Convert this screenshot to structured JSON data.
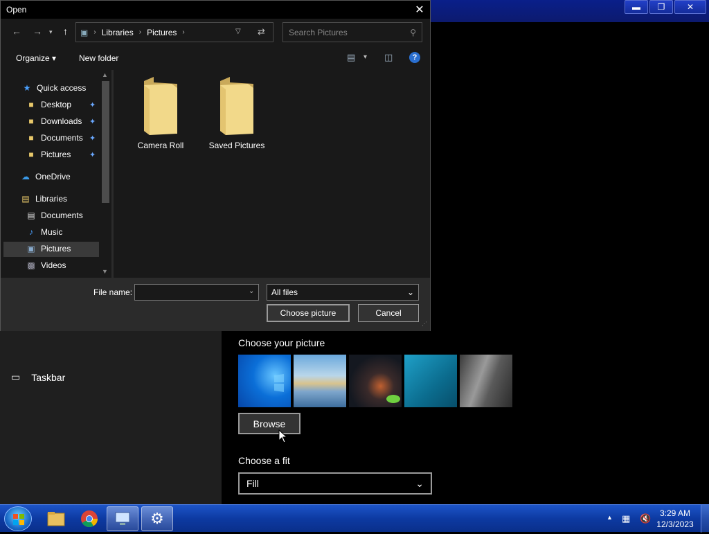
{
  "dialog": {
    "title": "Open",
    "breadcrumb": [
      "Libraries",
      "Pictures"
    ],
    "search_placeholder": "Search Pictures",
    "organize_label": "Organize",
    "new_folder_label": "New folder",
    "nav_items": {
      "quick_access": "Quick access",
      "desktop": "Desktop",
      "downloads": "Downloads",
      "documents_qa": "Documents",
      "pictures_qa": "Pictures",
      "onedrive": "OneDrive",
      "libraries": "Libraries",
      "documents_lib": "Documents",
      "music": "Music",
      "pictures_lib": "Pictures",
      "videos": "Videos"
    },
    "folders": [
      "Camera Roll",
      "Saved Pictures"
    ],
    "file_name_label": "File name:",
    "file_name_value": "",
    "file_type_value": "All files",
    "choose_button": "Choose picture",
    "cancel_button": "Cancel"
  },
  "settings": {
    "taskbar_nav_label": "Taskbar",
    "choose_picture_label": "Choose your picture",
    "browse_button": "Browse",
    "choose_fit_label": "Choose a fit",
    "fit_value": "Fill"
  },
  "taskbar": {
    "time": "3:29 AM",
    "date": "12/3/2023"
  },
  "colors": {
    "accent": "#0078d7",
    "taskbar": "#0d3aa2",
    "dialog_bg": "#2b2b2b"
  }
}
